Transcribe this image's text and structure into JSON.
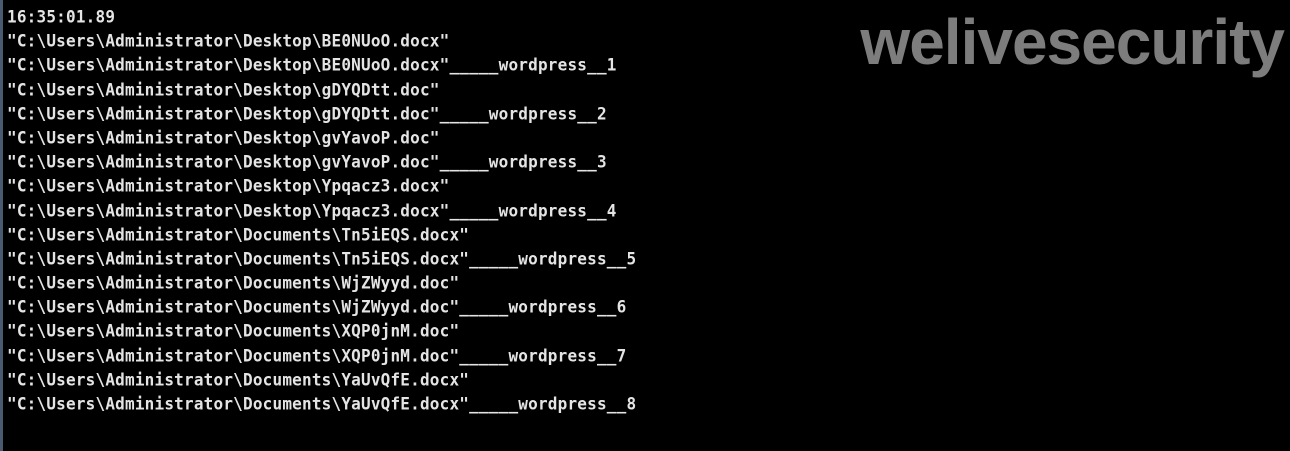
{
  "console": {
    "lines": [
      "16:35:01.89",
      "\"C:\\Users\\Administrator\\Desktop\\BE0NUoO.docx\"",
      "\"C:\\Users\\Administrator\\Desktop\\BE0NUoO.docx\"_____wordpress__1",
      "\"C:\\Users\\Administrator\\Desktop\\gDYQDtt.doc\"",
      "\"C:\\Users\\Administrator\\Desktop\\gDYQDtt.doc\"_____wordpress__2",
      "\"C:\\Users\\Administrator\\Desktop\\gvYavoP.doc\"",
      "\"C:\\Users\\Administrator\\Desktop\\gvYavoP.doc\"_____wordpress__3",
      "\"C:\\Users\\Administrator\\Desktop\\Ypqacz3.docx\"",
      "\"C:\\Users\\Administrator\\Desktop\\Ypqacz3.docx\"_____wordpress__4",
      "\"C:\\Users\\Administrator\\Documents\\Tn5iEQS.docx\"",
      "\"C:\\Users\\Administrator\\Documents\\Tn5iEQS.docx\"_____wordpress__5",
      "\"C:\\Users\\Administrator\\Documents\\WjZWyyd.doc\"",
      "\"C:\\Users\\Administrator\\Documents\\WjZWyyd.doc\"_____wordpress__6",
      "\"C:\\Users\\Administrator\\Documents\\XQP0jnM.doc\"",
      "\"C:\\Users\\Administrator\\Documents\\XQP0jnM.doc\"_____wordpress__7",
      "\"C:\\Users\\Administrator\\Documents\\YaUvQfE.docx\"",
      "\"C:\\Users\\Administrator\\Documents\\YaUvQfE.docx\"_____wordpress__8"
    ]
  },
  "watermark": {
    "text": "welivesecurity"
  },
  "colors": {
    "background": "#000000",
    "text": "#e4e4e4",
    "watermark": "#7d7d7d"
  }
}
